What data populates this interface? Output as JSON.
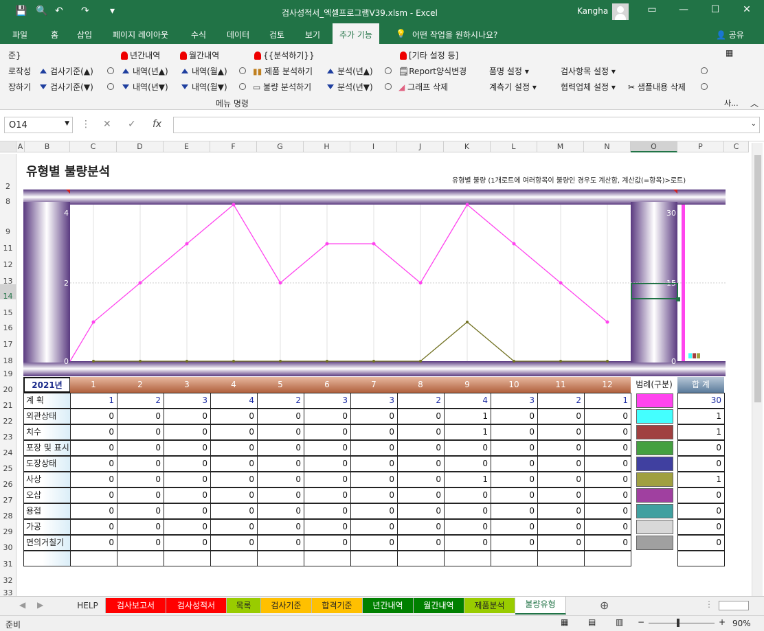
{
  "window": {
    "title": "검사성적서_엑셀프로그램V39.xlsm  -  Excel",
    "user": "Kangha"
  },
  "menu": {
    "tabs": [
      "파일",
      "홈",
      "삽입",
      "페이지 레이아웃",
      "수식",
      "데이터",
      "검토",
      "보기",
      "추가 기능"
    ],
    "active": "추가 기능",
    "tell_me": "어떤 작업을 원하시나요?",
    "share": "공유"
  },
  "ribbon": {
    "r1_cut": "준}",
    "r2_cut": "로작성",
    "r3_cut": "장하기",
    "yearly": "년간내역",
    "monthly": "월간내역",
    "analyze": "{{분석하기}}",
    "other": "[기타 설정 등]",
    "insp_up": "검사기준(▲)",
    "insp_down": "검사기준(▼)",
    "detail_year_up": "내역(년▲)",
    "detail_year_down": "내역(년▼)",
    "detail_month_up": "내역(월▲)",
    "detail_month_down": "내역(월▼)",
    "product_analysis": "제품 분석하기",
    "defect_analysis": "불량 분석하기",
    "analysis_year_up": "분석(년▲)",
    "analysis_year_down": "분석(년▼)",
    "report_change": "Report양식변경",
    "graph_delete": "그래프 삭제",
    "item_setting": "품명 설정",
    "meter_setting": "계측기 설정",
    "insp_item_setting": "검사항목 설정",
    "partner_setting": "협력업체 설정",
    "sample_delete": "샘플내용 삭제",
    "group_label": "메뉴 명령",
    "side_label": "사..."
  },
  "formula_bar": {
    "name_box": "O14",
    "formula": ""
  },
  "columns": [
    "A",
    "B",
    "C",
    "D",
    "E",
    "F",
    "G",
    "H",
    "I",
    "J",
    "K",
    "L",
    "M",
    "N",
    "O",
    "P",
    "C"
  ],
  "rows": [
    "2",
    "8",
    "9",
    "11",
    "12",
    "13",
    "14",
    "15",
    "16",
    "17",
    "18",
    "19",
    "20",
    "21",
    "22",
    "23",
    "24",
    "25",
    "26",
    "27",
    "28",
    "29",
    "30",
    "31",
    "32",
    "33"
  ],
  "sheet": {
    "title": "유형별 불량분석",
    "note": "유형별 불량 (1개로트에 여러항목이 불량인 경우도 계산함, 계산값(=항목)>로트)",
    "year_label": "2021년",
    "legend_header": "범례(구분)",
    "total_header": "합  계",
    "months": [
      "1",
      "2",
      "3",
      "4",
      "5",
      "6",
      "7",
      "8",
      "9",
      "10",
      "11",
      "12"
    ]
  },
  "table_rows": [
    {
      "label": "계  획",
      "values": [
        1,
        2,
        3,
        4,
        2,
        3,
        3,
        2,
        4,
        3,
        2,
        1
      ],
      "total": 30,
      "color": "#ff44ee",
      "plan": true
    },
    {
      "label": "외관상태",
      "values": [
        0,
        0,
        0,
        0,
        0,
        0,
        0,
        0,
        1,
        0,
        0,
        0
      ],
      "total": 1,
      "color": "#44ffff"
    },
    {
      "label": "치수",
      "values": [
        0,
        0,
        0,
        0,
        0,
        0,
        0,
        0,
        1,
        0,
        0,
        0
      ],
      "total": 1,
      "color": "#a04040"
    },
    {
      "label": "포장 및 표시",
      "values": [
        0,
        0,
        0,
        0,
        0,
        0,
        0,
        0,
        0,
        0,
        0,
        0
      ],
      "total": 0,
      "color": "#44a040"
    },
    {
      "label": "도장상태",
      "values": [
        0,
        0,
        0,
        0,
        0,
        0,
        0,
        0,
        0,
        0,
        0,
        0
      ],
      "total": 0,
      "color": "#4040a0"
    },
    {
      "label": "사상",
      "values": [
        0,
        0,
        0,
        0,
        0,
        0,
        0,
        0,
        1,
        0,
        0,
        0
      ],
      "total": 1,
      "color": "#a0a040"
    },
    {
      "label": "오삽",
      "values": [
        0,
        0,
        0,
        0,
        0,
        0,
        0,
        0,
        0,
        0,
        0,
        0
      ],
      "total": 0,
      "color": "#a040a0"
    },
    {
      "label": "용접",
      "values": [
        0,
        0,
        0,
        0,
        0,
        0,
        0,
        0,
        0,
        0,
        0,
        0
      ],
      "total": 0,
      "color": "#40a0a0"
    },
    {
      "label": "가공",
      "values": [
        0,
        0,
        0,
        0,
        0,
        0,
        0,
        0,
        0,
        0,
        0,
        0
      ],
      "total": 0,
      "color": "#d8d8d8"
    },
    {
      "label": "면의거칠기",
      "values": [
        0,
        0,
        0,
        0,
        0,
        0,
        0,
        0,
        0,
        0,
        0,
        0
      ],
      "total": 0,
      "color": "#a0a0a0"
    }
  ],
  "chart_data": {
    "type": "line",
    "categories": [
      "1",
      "2",
      "3",
      "4",
      "5",
      "6",
      "7",
      "8",
      "9",
      "10",
      "11",
      "12"
    ],
    "y_left_ticks": [
      "0",
      "2",
      "4"
    ],
    "y_right_ticks": [
      "0",
      "15",
      "30"
    ],
    "ylim": [
      0,
      4
    ],
    "series": [
      {
        "name": "계  획",
        "values": [
          1,
          2,
          3,
          4,
          2,
          3,
          3,
          2,
          4,
          3,
          2,
          1
        ],
        "color": "#ff44ee"
      },
      {
        "name": "사상",
        "values": [
          0,
          0,
          0,
          0,
          0,
          0,
          0,
          0,
          1,
          0,
          0,
          0
        ],
        "color": "#707020"
      }
    ],
    "totals_bars": [
      {
        "name": "계  획",
        "value": 30,
        "color": "#ff44ee"
      },
      {
        "name": "외관상태",
        "value": 1,
        "color": "#44ffff"
      },
      {
        "name": "치수",
        "value": 1,
        "color": "#a04040"
      },
      {
        "name": "사상",
        "value": 1,
        "color": "#a0a040"
      }
    ],
    "grid": true
  },
  "sheet_tabs": [
    {
      "label": "HELP",
      "bg": "#f0f0f0",
      "fg": "#333"
    },
    {
      "label": "검사보고서",
      "bg": "#ff0000",
      "fg": "#fff"
    },
    {
      "label": "검사성적서",
      "bg": "#ff0000",
      "fg": "#fff"
    },
    {
      "label": "목록",
      "bg": "#99cc00",
      "fg": "#222"
    },
    {
      "label": "검사기준",
      "bg": "#ffc000",
      "fg": "#222"
    },
    {
      "label": "합격기준",
      "bg": "#ffc000",
      "fg": "#222"
    },
    {
      "label": "년간내역",
      "bg": "#008000",
      "fg": "#fff"
    },
    {
      "label": "월간내역",
      "bg": "#008000",
      "fg": "#fff"
    },
    {
      "label": "제품분석",
      "bg": "#99cc00",
      "fg": "#222"
    },
    {
      "label": "불량유형",
      "bg": "#ffffff",
      "fg": "#217346"
    }
  ],
  "status": {
    "ready": "준비",
    "zoom": "90%"
  }
}
